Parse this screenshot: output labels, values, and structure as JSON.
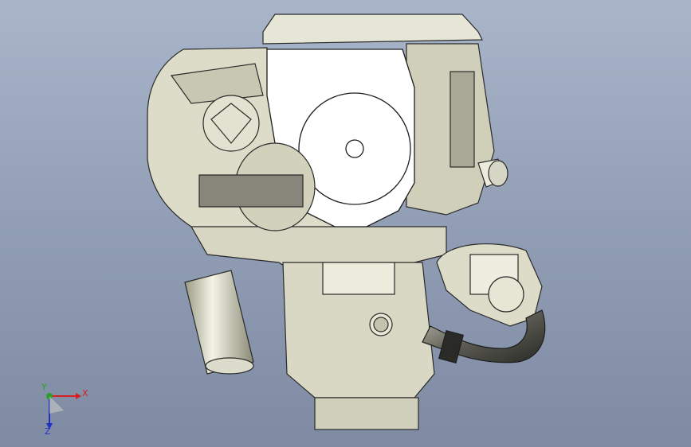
{
  "viewport": {
    "background_top": "#a9b5c9",
    "background_bottom": "#7f8ba3",
    "model_fill": "#dcdcc8",
    "model_stroke": "#2a2a2a"
  },
  "triad": {
    "x_label": "X",
    "y_label": "Y",
    "z_label": "Z",
    "x_color": "#d42020",
    "y_color": "#2aa02a",
    "z_color": "#2030c0"
  }
}
